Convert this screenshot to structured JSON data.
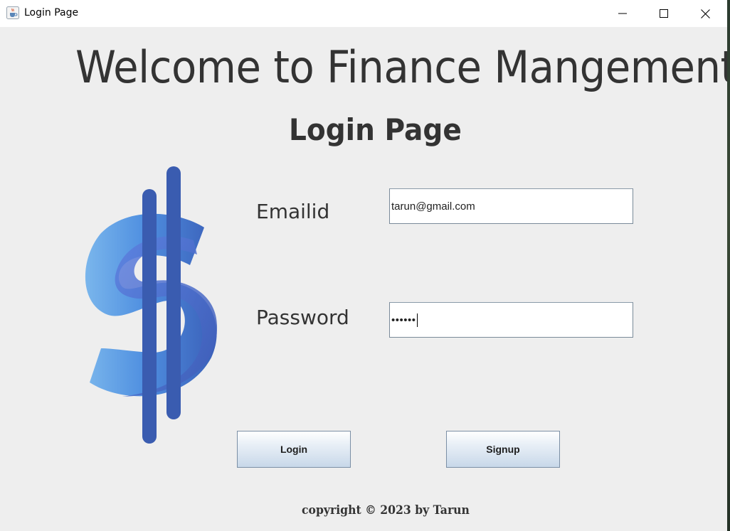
{
  "window": {
    "title": "Login Page",
    "app_icon": "java-cup-icon",
    "controls": [
      "minimize-icon",
      "maximize-icon",
      "close-icon"
    ]
  },
  "heading": "Welcome to Finance Mangement",
  "subheading": "Login Page",
  "logo": {
    "icon": "dollar-sign-icon",
    "colors": [
      "#5b9ee6",
      "#3a5fb8"
    ]
  },
  "form": {
    "email_label": "Emailid",
    "email_value": "tarun@gmail.com",
    "password_label": "Password",
    "password_value": "••••••"
  },
  "buttons": {
    "login": "Login",
    "signup": "Signup"
  },
  "footer": {
    "copyright": "copyright © 2023 by Tarun"
  },
  "colors": {
    "background": "#eeeeee",
    "text": "#333333",
    "button_gradient_top": "#ffffff",
    "button_gradient_bottom": "#c8d8e9",
    "button_border": "#7b8fa5"
  }
}
